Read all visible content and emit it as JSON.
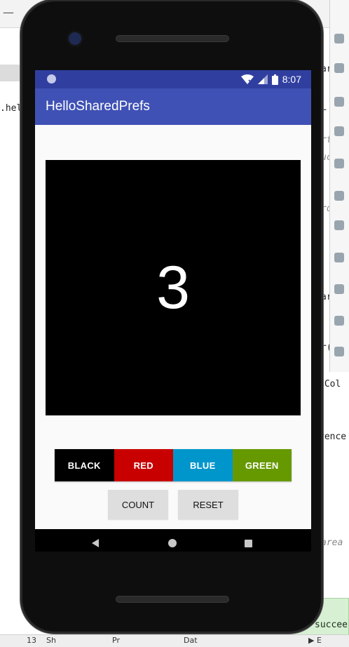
{
  "ide": {
    "minimize_symbol": "—",
    "code_fragments": [
      ".hell",
      "ar",
      "r",
      "rt",
      "uc",
      "rd",
      "ar",
      "r(",
      "dCol",
      "rence",
      "area",
      "succee"
    ],
    "bottom_items": [
      "13",
      "Sh",
      "Pr",
      "Dat",
      "▶ E"
    ]
  },
  "status_bar": {
    "time": "8:07"
  },
  "app_bar": {
    "title": "HelloSharedPrefs"
  },
  "main": {
    "count": "3",
    "count_background": "#000000"
  },
  "color_buttons": [
    {
      "label": "BLACK",
      "color": "#000000"
    },
    {
      "label": "RED",
      "color": "#c80000"
    },
    {
      "label": "BLUE",
      "color": "#0096cc"
    },
    {
      "label": "GREEN",
      "color": "#669900"
    }
  ],
  "actions": {
    "count_label": "COUNT",
    "reset_label": "RESET"
  },
  "nav": {
    "icons": [
      "back-icon",
      "home-icon",
      "recents-icon"
    ]
  },
  "colors": {
    "status_bar": "#303f9f",
    "app_bar": "#3f51b5",
    "content_bg": "#fafafa"
  }
}
